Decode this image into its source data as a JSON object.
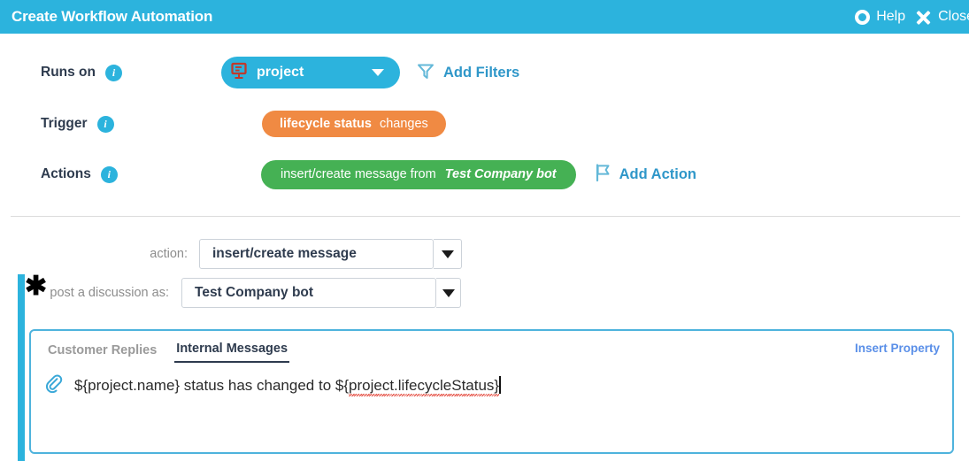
{
  "header": {
    "title": "Create Workflow Automation",
    "help_label": "Help",
    "close_label": "Close",
    "help_icon": "lifering-icon",
    "close_icon": "close-x-icon",
    "background_color": "#2cb3dd"
  },
  "rows": {
    "runs_on": {
      "label": "Runs on",
      "info_icon": "i",
      "pill_text": "project",
      "pill_icon": "project-board-icon",
      "pill_color": "#2cb3dd",
      "pill_icon_color": "#c0392b",
      "link_label": "Add Filters",
      "link_icon": "filter-funnel-icon",
      "link_color": "#2f97c9"
    },
    "trigger": {
      "label": "Trigger",
      "info_icon": "i",
      "pill_strong": "lifecycle status",
      "pill_normal": "changes",
      "pill_color": "#f08a43"
    },
    "actions": {
      "label": "Actions",
      "info_icon": "i",
      "pill_normal": "insert/create message from",
      "pill_strong": "Test Company bot",
      "pill_color": "#45b154",
      "link_label": "Add Action",
      "link_icon": "flag-icon",
      "link_color": "#2f97c9"
    }
  },
  "form": {
    "action_label": "action:",
    "action_value": "insert/create message",
    "post_as_label": "post a discussion as:",
    "post_as_value": "Test Company bot",
    "required_marker": "✱"
  },
  "editor": {
    "tabs": [
      {
        "label": "Customer Replies",
        "active": false
      },
      {
        "label": "Internal Messages",
        "active": true
      }
    ],
    "insert_property_label": "Insert Property",
    "attach_icon": "paperclip-icon",
    "message_prefix": "${project.name} status has changed to ${",
    "message_misspelled": "project.lifecycleStatus}",
    "border_color": "#4eb3dd"
  }
}
